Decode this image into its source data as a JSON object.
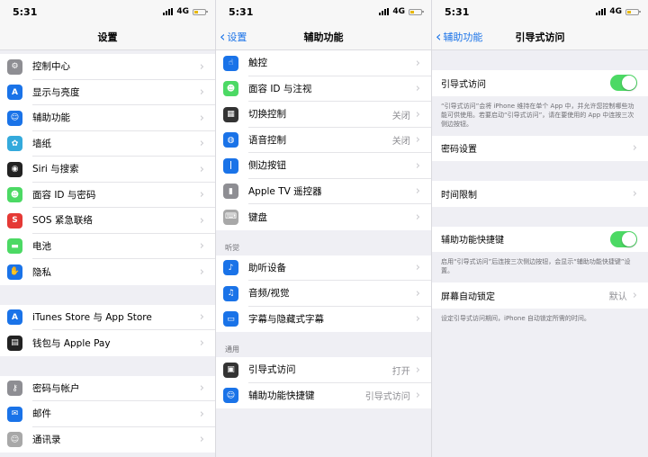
{
  "status": {
    "time": "5:31",
    "network": "4G"
  },
  "panel1": {
    "title": "设置",
    "groups": [
      [
        {
          "label": "控制中心",
          "icon": "control-center-icon",
          "color": "#8e8e93"
        },
        {
          "label": "显示与亮度",
          "icon": "display-icon",
          "color": "#1a73e8"
        },
        {
          "label": "辅助功能",
          "icon": "accessibility-icon",
          "color": "#1a73e8"
        },
        {
          "label": "墙纸",
          "icon": "wallpaper-icon",
          "color": "#34aadc"
        },
        {
          "label": "Siri 与搜索",
          "icon": "siri-icon",
          "color": "#222222"
        },
        {
          "label": "面容 ID 与密码",
          "icon": "face-id-icon",
          "color": "#4cd964"
        },
        {
          "label": "SOS 紧急联络",
          "icon": "sos-icon",
          "color": "#e53935"
        },
        {
          "label": "电池",
          "icon": "battery-icon",
          "color": "#4cd964"
        },
        {
          "label": "隐私",
          "icon": "privacy-hand-icon",
          "color": "#1a73e8"
        }
      ],
      [
        {
          "label": "iTunes Store 与 App Store",
          "icon": "app-store-icon",
          "color": "#1a73e8"
        },
        {
          "label": "钱包与 Apple Pay",
          "icon": "wallet-icon",
          "color": "#222222"
        }
      ],
      [
        {
          "label": "密码与帐户",
          "icon": "key-icon",
          "color": "#8e8e93"
        },
        {
          "label": "邮件",
          "icon": "mail-icon",
          "color": "#1a73e8"
        },
        {
          "label": "通讯录",
          "icon": "contacts-icon",
          "color": "#a8a8a8"
        }
      ]
    ]
  },
  "panel2": {
    "back": "设置",
    "title": "辅助功能",
    "group1": [
      {
        "label": "触控",
        "icon": "touch-icon",
        "color": "#1a73e8",
        "value": ""
      },
      {
        "label": "面容 ID 与注视",
        "icon": "face-id-icon",
        "color": "#4cd964",
        "value": ""
      },
      {
        "label": "切换控制",
        "icon": "switch-control-icon",
        "color": "#333333",
        "value": "关闭"
      },
      {
        "label": "语音控制",
        "icon": "voice-control-icon",
        "color": "#1a73e8",
        "value": "关闭"
      },
      {
        "label": "侧边按钮",
        "icon": "side-button-icon",
        "color": "#1a73e8",
        "value": ""
      },
      {
        "label": "Apple TV 遥控器",
        "icon": "remote-icon",
        "color": "#8e8e93",
        "value": ""
      },
      {
        "label": "键盘",
        "icon": "keyboard-icon",
        "color": "#a8a8a8",
        "value": ""
      }
    ],
    "section_hearing": "听觉",
    "group2": [
      {
        "label": "助听设备",
        "icon": "ear-icon",
        "color": "#1a73e8",
        "value": ""
      },
      {
        "label": "音频/视觉",
        "icon": "audio-visual-icon",
        "color": "#1a73e8",
        "value": ""
      },
      {
        "label": "字幕与隐藏式字幕",
        "icon": "captions-icon",
        "color": "#1a73e8",
        "value": ""
      }
    ],
    "section_general": "通用",
    "group3": [
      {
        "label": "引导式访问",
        "icon": "lock-icon",
        "color": "#333333",
        "value": "打开"
      },
      {
        "label": "辅助功能快捷键",
        "icon": "accessibility-icon",
        "color": "#1a73e8",
        "value": "引导式访问"
      }
    ]
  },
  "panel3": {
    "back": "辅助功能",
    "title": "引导式访问",
    "guided_access": {
      "label": "引导式访问",
      "on": true
    },
    "guided_note": "“引导式访问”会将 iPhone 维持在单个 App 中，并允许您控制哪些功能可供使用。若要启动“引导式访问”，请在要使用的 App 中连按三次侧边按钮。",
    "passcode": "密码设置",
    "time_limit": "时间限制",
    "shortcut": {
      "label": "辅助功能快捷键",
      "on": true
    },
    "shortcut_note": "启用“引导式访问”后连按三次侧边按钮，会显示“辅助功能快捷键”设置。",
    "auto_lock": {
      "label": "屏幕自动锁定",
      "value": "默认"
    },
    "auto_lock_note": "设定引导式访问期间，iPhone 自动锁定所需的时间。"
  }
}
